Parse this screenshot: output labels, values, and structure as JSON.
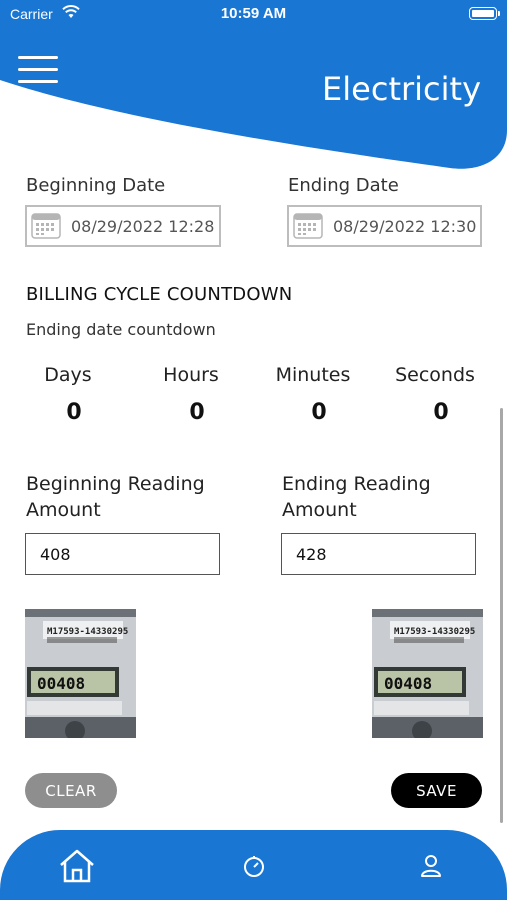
{
  "status_bar": {
    "carrier": "Carrier",
    "time": "10:59 AM"
  },
  "header": {
    "title": "Electricity",
    "menu_icon": "hamburger-menu-icon",
    "color": "#1976d2"
  },
  "dates": {
    "beginning_label": "Beginning Date",
    "beginning_value": "08/29/2022 12:28",
    "ending_label": "Ending Date",
    "ending_value": "08/29/2022 12:30"
  },
  "countdown": {
    "title": "BILLING CYCLE COUNTDOWN",
    "subtitle": "Ending date countdown",
    "units": [
      {
        "label": "Days",
        "value": "0"
      },
      {
        "label": "Hours",
        "value": "0"
      },
      {
        "label": "Minutes",
        "value": "0"
      },
      {
        "label": "Seconds",
        "value": "0"
      }
    ]
  },
  "readings": {
    "beginning_label": "Beginning Reading Amount",
    "beginning_value": "408",
    "ending_label": "Ending Reading Amount",
    "ending_value": "428"
  },
  "meter_photos": {
    "beginning": {
      "serial": "M17593-14330295",
      "display": "00408"
    },
    "ending": {
      "serial": "M17593-14330295",
      "display": "00408"
    }
  },
  "actions": {
    "clear_label": "CLEAR",
    "save_label": "SAVE"
  },
  "bottom_nav": {
    "items": [
      "home-icon",
      "timer-icon",
      "profile-icon"
    ],
    "color": "#1976d2"
  }
}
